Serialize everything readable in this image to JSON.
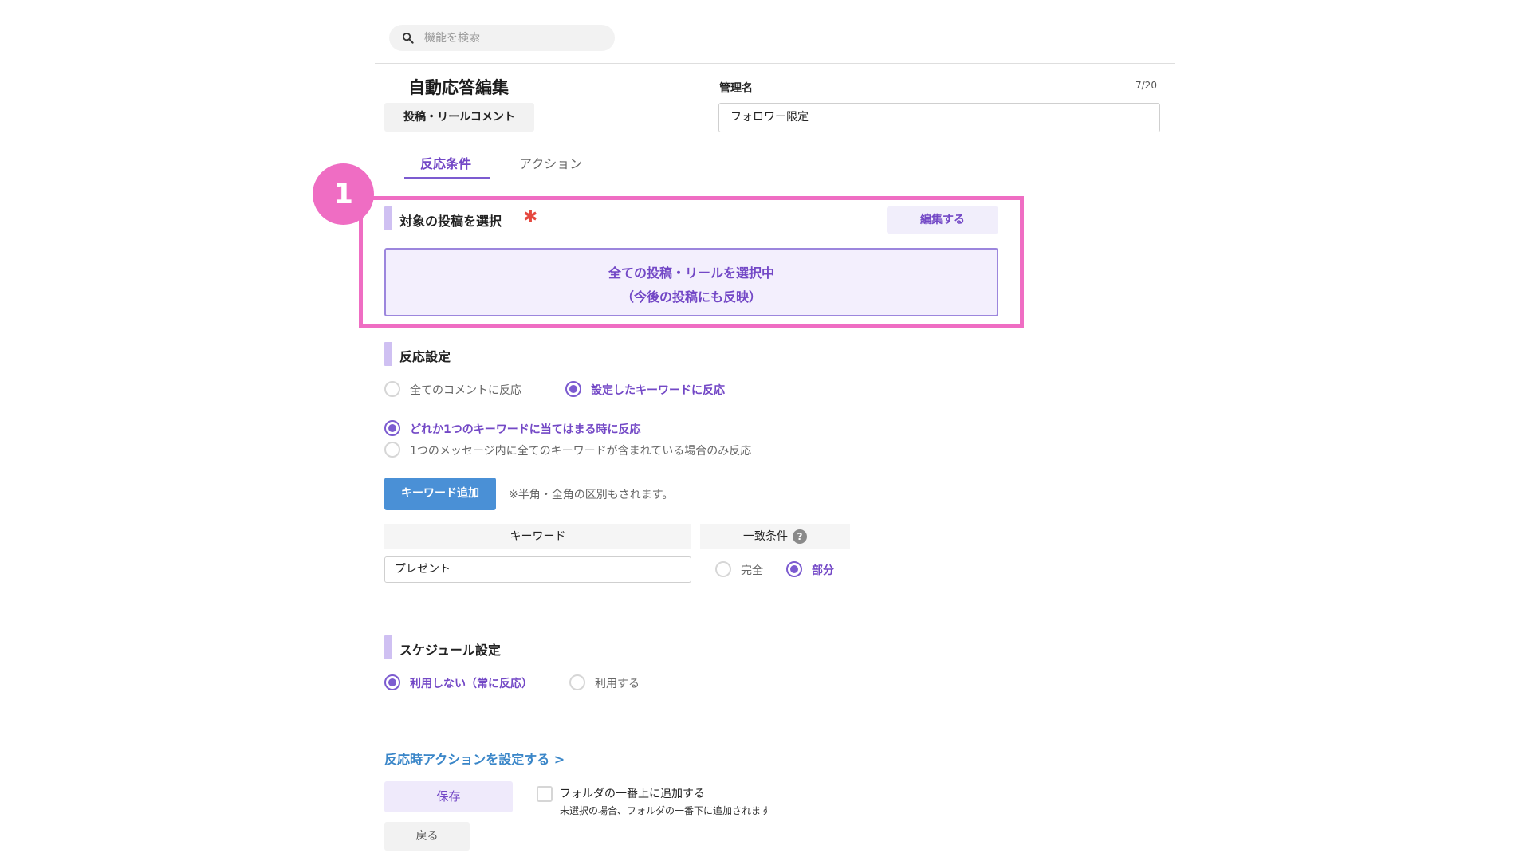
{
  "search": {
    "placeholder": "機能を検索",
    "icon": "search-icon"
  },
  "header": {
    "title": "自動応答編集",
    "type_badge": "投稿・リールコメント",
    "management_name_label": "管理名",
    "management_name_count": "7/20",
    "management_name_value": "フォロワー限定"
  },
  "tabs": [
    {
      "label": "反応条件",
      "active": true
    },
    {
      "label": "アクション",
      "active": false
    }
  ],
  "annotation": {
    "step_number": "1",
    "color": "#ef6dc3"
  },
  "target_section": {
    "title": "対象の投稿を選択",
    "required_mark": "✱",
    "edit_label": "編集する",
    "selection_line1": "全ての投稿・リールを選択中",
    "selection_line2": "（今後の投稿にも反映）"
  },
  "reaction_section": {
    "title": "反応設定",
    "mode_options": [
      {
        "label": "全てのコメントに反応",
        "selected": false
      },
      {
        "label": "設定したキーワードに反応",
        "selected": true
      }
    ],
    "match_options": [
      {
        "label": "どれか1つのキーワードに当てはまる時に反応",
        "selected": true
      },
      {
        "label": "1つのメッセージ内に全てのキーワードが含まれている場合のみ反応",
        "selected": false
      }
    ],
    "add_keyword_label": "キーワード追加",
    "note": "※半角・全角の区別もされます。",
    "keyword_header": "キーワード",
    "match_header": "一致条件",
    "help_glyph": "?",
    "keyword_value": "プレゼント",
    "match_type_options": [
      {
        "label": "完全",
        "selected": false
      },
      {
        "label": "部分",
        "selected": true
      }
    ]
  },
  "schedule_section": {
    "title": "スケジュール設定",
    "options": [
      {
        "label": "利用しない（常に反応）",
        "selected": true
      },
      {
        "label": "利用する",
        "selected": false
      }
    ]
  },
  "footer": {
    "action_link": "反応時アクションを設定する >",
    "save_label": "保存",
    "back_label": "戻る",
    "folder_checkbox_label": "フォルダの一番上に追加する",
    "folder_checkbox_sub": "未選択の場合、フォルダの一番下に追加されます",
    "folder_checked": false
  },
  "colors": {
    "accent": "#7c5bd0",
    "accent_text": "#7348c6",
    "primary_button": "#4a90d6",
    "link": "#3a86c8",
    "highlight": "#ef6dc3",
    "required": "#e5483f"
  }
}
